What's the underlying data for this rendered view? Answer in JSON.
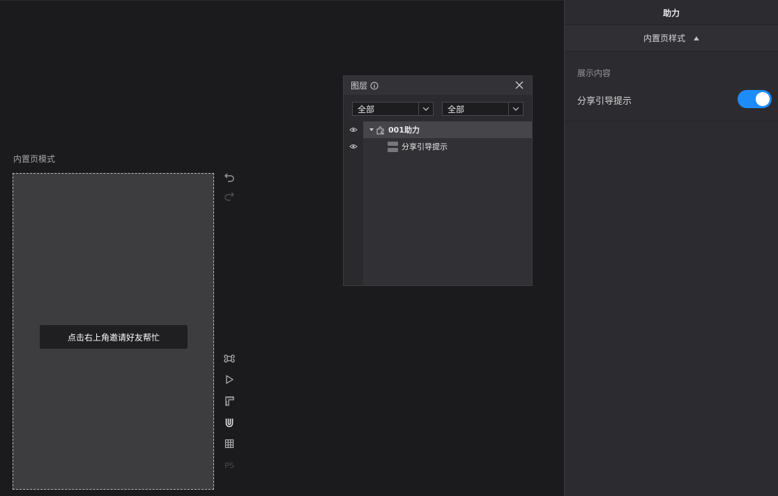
{
  "canvas": {
    "mode_label": "内置页模式",
    "phone_toast": "点击右上角邀请好友帮忙"
  },
  "tools": {
    "side": [
      {
        "icon": "undo-icon"
      },
      {
        "icon": "redo-icon"
      },
      {
        "icon": "command-icon"
      },
      {
        "icon": "play-icon"
      },
      {
        "icon": "ruler-icon"
      },
      {
        "icon": "magnet-icon"
      },
      {
        "icon": "grid-icon"
      },
      {
        "icon": "ps-icon",
        "label": "PS"
      }
    ]
  },
  "layers_panel": {
    "title": "图层",
    "filter_left": "全部",
    "filter_right": "全部",
    "rows": [
      {
        "label": "001助力",
        "selected": true
      },
      {
        "label": "分享引导提示",
        "selected": false
      }
    ]
  },
  "right_panel": {
    "title": "助力",
    "section_title": "内置页样式",
    "caption": "展示内容",
    "toggle_label": "分享引导提示",
    "toggle_on": true
  },
  "colors": {
    "accent": "#1d8cf8",
    "background": "#1b1b1e",
    "panel": "#2c2c30"
  }
}
